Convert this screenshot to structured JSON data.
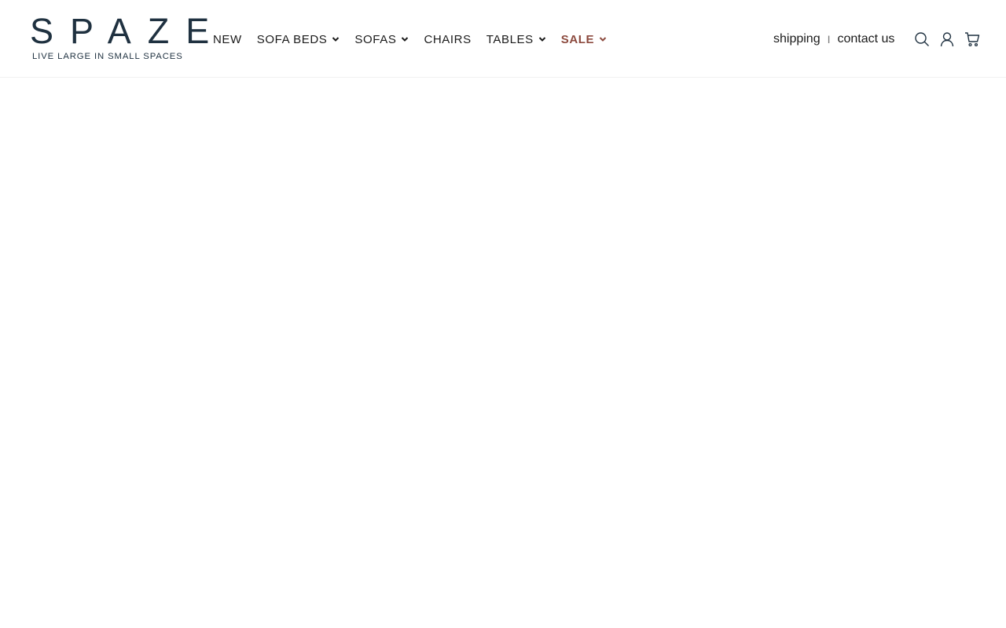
{
  "logo": {
    "wordmark": "SPAZE",
    "tagline": "LIVE LARGE IN SMALL SPACES"
  },
  "nav": {
    "items": [
      {
        "label": "NEW",
        "has_dropdown": false
      },
      {
        "label": "SOFA BEDS",
        "has_dropdown": true
      },
      {
        "label": "SOFAS",
        "has_dropdown": true
      },
      {
        "label": "CHAIRS",
        "has_dropdown": false
      },
      {
        "label": "TABLES",
        "has_dropdown": true
      },
      {
        "label": "SALE",
        "has_dropdown": true
      }
    ]
  },
  "utility": {
    "shipping": "shipping",
    "separator": "I",
    "contact": "contact us"
  },
  "icons": {
    "search": "search-icon",
    "account": "user-icon",
    "cart": "cart-icon"
  },
  "colors": {
    "brand": "#1f3140",
    "sale": "#8c4a3e",
    "text": "#1a1a1a"
  }
}
